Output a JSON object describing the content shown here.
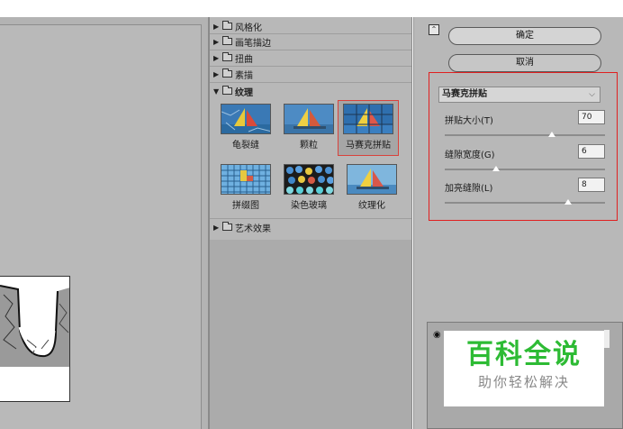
{
  "gallery": {
    "categories": [
      {
        "label": "风格化",
        "open": false
      },
      {
        "label": "画笔描边",
        "open": false
      },
      {
        "label": "扭曲",
        "open": false
      },
      {
        "label": "素描",
        "open": false
      },
      {
        "label": "纹理",
        "open": true
      },
      {
        "label": "艺术效果",
        "open": false
      }
    ],
    "texture_filters": [
      {
        "label": "龟裂缝"
      },
      {
        "label": "颗粒"
      },
      {
        "label": "马赛克拼贴"
      },
      {
        "label": "拼缀图"
      },
      {
        "label": "染色玻璃"
      },
      {
        "label": "纹理化"
      }
    ],
    "selected_index": 2
  },
  "settings": {
    "ok_label": "确定",
    "cancel_label": "取消",
    "filter_select_value": "马赛克拼贴",
    "params": [
      {
        "label": "拼贴大小(T)",
        "value": "70",
        "fraction": 0.67
      },
      {
        "label": "缝隙宽度(G)",
        "value": "6",
        "fraction": 0.32
      },
      {
        "label": "加亮缝隙(L)",
        "value": "8",
        "fraction": 0.77
      }
    ]
  },
  "watermark": {
    "title": "百科全说",
    "subtitle": "助你轻松解决"
  },
  "colors": {
    "highlight_red": "#e02020",
    "watermark_green": "#2dbb34"
  }
}
